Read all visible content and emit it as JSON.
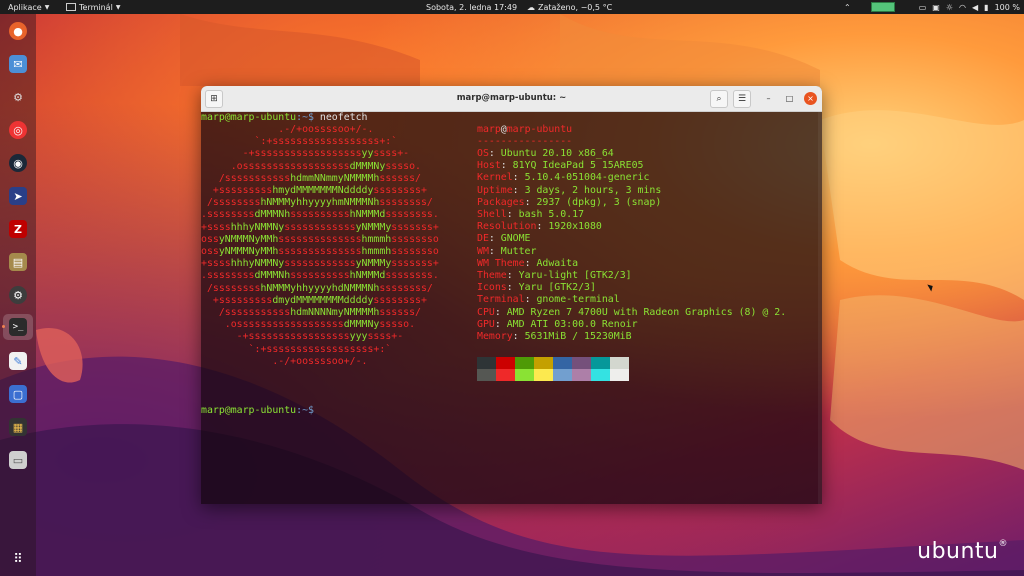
{
  "topbar": {
    "activities": "Aplikace",
    "app_menu": "Terminál",
    "clock": "Sobota, 2. ledna  17:49",
    "weather": "Zataženo, −0,5 °C",
    "battery": "100 %"
  },
  "dock": {
    "items": [
      "firefox-icon",
      "mail-icon",
      "vm-icon",
      "lifesaver-icon",
      "steam-icon",
      "shuttle-icon",
      "filezilla-icon",
      "archive-icon",
      "settings-icon",
      "terminal-icon",
      "text-editor-icon",
      "screenshot-icon",
      "calculator-icon",
      "files-icon",
      "app-grid-icon"
    ]
  },
  "terminal": {
    "title": "marp@marp-ubuntu: ~",
    "prompt_user": "marp@marp-ubuntu",
    "prompt_path": ":~$",
    "command": " neofetch",
    "art_lines": [
      "             .-/+oossssoo+/-.",
      "         `:+ssssssssssssssssss+:`",
      "       -+ssssssssssssssssssyyssss+-",
      "     .ossssssssssssssssssdMMMNysssso.",
      "   /ssssssssssshdmmNNmmyNMMMMhssssss/",
      "  +ssssssssshmydMMMMMMMNddddyssssssss+",
      " /sssssssshNMMMyhhyyyyhmNMMMNhssssssss/",
      ".ssssssssdMMMNhsssssssssshNMMMdssssssss.",
      "+sssshhhyNMMNyssssssssssssyNMMMysssssss+",
      "ossyNMMMNyMMhsssssssssssssshmmmhssssssso",
      "ossyNMMMNyMMhsssssssssssssshmmmhssssssso",
      "+sssshhhyNMMNyssssssssssssyNMMMysssssss+",
      ".ssssssssdMMMNhsssssssssshNMMMdssssssss.",
      " /sssssssshNMMMyhhyyyyhdNMMMNhssssssss/",
      "  +sssssssssdmydMMMMMMMMddddyssssssss+",
      "   /ssssssssssshdmNNNNmyNMMMMhssssss/",
      "    .ossssssssssssssssssdMMMNysssso.",
      "      -+sssssssssssssssssyyyssss+-",
      "        `:+ssssssssssssssssss+:`",
      "            .-/+oossssoo+/-."
    ],
    "info": {
      "user": "marp",
      "at": "@",
      "host": "marp-ubuntu",
      "separator": "----------------",
      "rows": [
        {
          "label": "OS",
          "value": "Ubuntu 20.10 x86_64"
        },
        {
          "label": "Host",
          "value": "81YQ IdeaPad 5 15ARE05"
        },
        {
          "label": "Kernel",
          "value": "5.10.4-051004-generic"
        },
        {
          "label": "Uptime",
          "value": "3 days, 2 hours, 3 mins"
        },
        {
          "label": "Packages",
          "value": "2937 (dpkg), 3 (snap)"
        },
        {
          "label": "Shell",
          "value": "bash 5.0.17"
        },
        {
          "label": "Resolution",
          "value": "1920x1080"
        },
        {
          "label": "DE",
          "value": "GNOME"
        },
        {
          "label": "WM",
          "value": "Mutter"
        },
        {
          "label": "WM Theme",
          "value": "Adwaita"
        },
        {
          "label": "Theme",
          "value": "Yaru-light [GTK2/3]"
        },
        {
          "label": "Icons",
          "value": "Yaru [GTK2/3]"
        },
        {
          "label": "Terminal",
          "value": "gnome-terminal"
        },
        {
          "label": "CPU",
          "value": "AMD Ryzen 7 4700U with Radeon Graphics (8) @ 2."
        },
        {
          "label": "GPU",
          "value": "AMD ATI 03:00.0 Renoir"
        },
        {
          "label": "Memory",
          "value": "5631MiB / 15230MiB"
        }
      ]
    },
    "palette_top": [
      "#2e3436",
      "#cc0000",
      "#4e9a06",
      "#c4a000",
      "#3465a4",
      "#75507b",
      "#06989a",
      "#d3d7cf"
    ],
    "palette_bottom": [
      "#555753",
      "#ef2929",
      "#8ae234",
      "#fce94f",
      "#729fcf",
      "#ad7fa8",
      "#34e2e2",
      "#eeeeec"
    ]
  },
  "branding": {
    "logo_text": "ubuntu",
    "logo_mark": "®"
  }
}
